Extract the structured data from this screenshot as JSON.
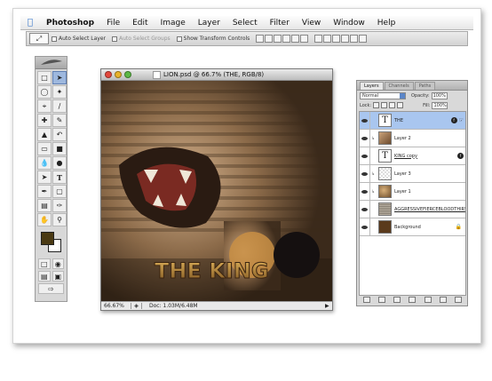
{
  "menubar": {
    "app_name": "Photoshop",
    "items": [
      "File",
      "Edit",
      "Image",
      "Layer",
      "Select",
      "Filter",
      "View",
      "Window",
      "Help"
    ]
  },
  "options_bar": {
    "auto_select_layer": "Auto Select Layer",
    "auto_select_groups": "Auto Select Groups",
    "show_transform_controls": "Show Transform Controls"
  },
  "document": {
    "title": "LION.psd @ 66.7% (THE, RGB/8)",
    "zoom": "66.67%",
    "doc_size": "Doc: 1.03M/6.48M",
    "artwork_text": "THE KING"
  },
  "layers_panel": {
    "tabs": [
      "Layers",
      "Channels",
      "Paths"
    ],
    "blend_mode": "Normal",
    "opacity_label": "Opacity:",
    "opacity_value": "100%",
    "lock_label": "Lock:",
    "fill_label": "Fill:",
    "fill_value": "100%",
    "layers": [
      {
        "name": "THE",
        "thumb": "text",
        "selected": true,
        "fx": true
      },
      {
        "name": "Layer 2",
        "thumb": "photo",
        "selected": false,
        "fx": false
      },
      {
        "name": "KING copy",
        "thumb": "text",
        "selected": false,
        "fx": true
      },
      {
        "name": "Layer 3",
        "thumb": "checker",
        "selected": false,
        "fx": false
      },
      {
        "name": "Layer 1",
        "thumb": "lion",
        "selected": false,
        "fx": false
      },
      {
        "name": "AGGRESSIVEFIERCEBLOODTHIRSTY...",
        "thumb": "words",
        "selected": false,
        "fx": false
      },
      {
        "name": "Background",
        "thumb": "bgbrown",
        "selected": false,
        "fx": false
      }
    ]
  },
  "colors": {
    "foreground": "#4a3a13",
    "background": "#ffffff",
    "selection": "#a9c6ef"
  }
}
